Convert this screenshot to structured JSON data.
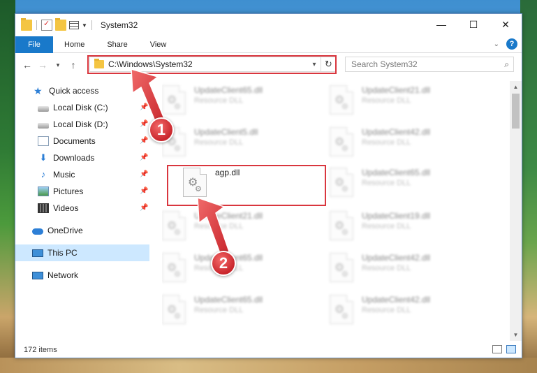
{
  "window": {
    "title": "System32",
    "controls": {
      "minimize": "—",
      "maximize": "☐",
      "close": "✕"
    }
  },
  "ribbon": {
    "tabs": [
      "File",
      "Home",
      "Share",
      "View"
    ]
  },
  "navbar": {
    "address": "C:\\Windows\\System32",
    "search_placeholder": "Search System32"
  },
  "sidebar": {
    "items": [
      {
        "label": "Quick access",
        "icon": "star-icon"
      },
      {
        "label": "Local Disk (C:)",
        "icon": "drive-icon",
        "pinned": true
      },
      {
        "label": "Local Disk (D:)",
        "icon": "drive-icon",
        "pinned": true
      },
      {
        "label": "Documents",
        "icon": "documents-icon",
        "pinned": true
      },
      {
        "label": "Downloads",
        "icon": "download-icon",
        "pinned": true
      },
      {
        "label": "Music",
        "icon": "music-icon",
        "pinned": true
      },
      {
        "label": "Pictures",
        "icon": "pictures-icon",
        "pinned": true
      },
      {
        "label": "Videos",
        "icon": "videos-icon",
        "pinned": true
      },
      {
        "label": "OneDrive",
        "icon": "cloud-icon"
      },
      {
        "label": "This PC",
        "icon": "computer-icon",
        "selected": true
      },
      {
        "label": "Network",
        "icon": "network-icon"
      }
    ]
  },
  "files": [
    {
      "name": "UpdateClient65.dll",
      "type": "Resource DLL"
    },
    {
      "name": "UpdateClient21.dll",
      "type": "Resource DLL"
    },
    {
      "name": "UpdateClient5.dll",
      "type": "Resource DLL"
    },
    {
      "name": "UpdateClient42.dll",
      "type": "Resource DLL"
    },
    {
      "name": "agp.dll",
      "type": ""
    },
    {
      "name": "UpdateClient65.dll",
      "type": "Resource DLL"
    },
    {
      "name": "UpdateClient21.dll",
      "type": "Resource DLL"
    },
    {
      "name": "UpdateClient19.dll",
      "type": "Resource DLL"
    },
    {
      "name": "UpdateClient65.dll",
      "type": "Resource DLL"
    },
    {
      "name": "UpdateClient42.dll",
      "type": "Resource DLL"
    },
    {
      "name": "UpdateClient65.dll",
      "type": "Resource DLL"
    },
    {
      "name": "UpdateClient42.dll",
      "type": "Resource DLL"
    }
  ],
  "status": {
    "item_count": "172 items"
  },
  "annotations": {
    "step1": "1",
    "step2": "2",
    "highlight_color": "#d9363e"
  }
}
